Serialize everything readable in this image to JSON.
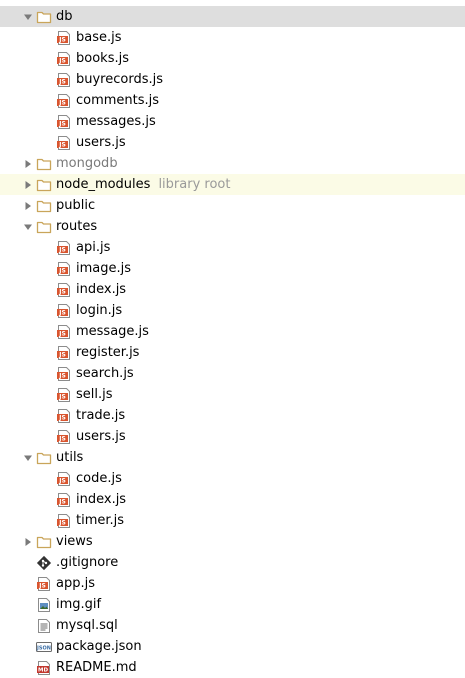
{
  "tree": [
    {
      "label": "db",
      "depth": 0,
      "type": "folder",
      "expanded": true,
      "selected": true
    },
    {
      "label": "base.js",
      "depth": 1,
      "type": "js"
    },
    {
      "label": "books.js",
      "depth": 1,
      "type": "js"
    },
    {
      "label": "buyrecords.js",
      "depth": 1,
      "type": "js"
    },
    {
      "label": "comments.js",
      "depth": 1,
      "type": "js"
    },
    {
      "label": "messages.js",
      "depth": 1,
      "type": "js"
    },
    {
      "label": "users.js",
      "depth": 1,
      "type": "js"
    },
    {
      "label": "mongodb",
      "depth": 0,
      "type": "folder",
      "expanded": false,
      "dim": true
    },
    {
      "label": "node_modules",
      "depth": 0,
      "type": "folder",
      "expanded": false,
      "hint": "library root"
    },
    {
      "label": "public",
      "depth": 0,
      "type": "folder",
      "expanded": false
    },
    {
      "label": "routes",
      "depth": 0,
      "type": "folder",
      "expanded": true
    },
    {
      "label": "api.js",
      "depth": 1,
      "type": "js"
    },
    {
      "label": "image.js",
      "depth": 1,
      "type": "js"
    },
    {
      "label": "index.js",
      "depth": 1,
      "type": "js"
    },
    {
      "label": "login.js",
      "depth": 1,
      "type": "js"
    },
    {
      "label": "message.js",
      "depth": 1,
      "type": "js"
    },
    {
      "label": "register.js",
      "depth": 1,
      "type": "js"
    },
    {
      "label": "search.js",
      "depth": 1,
      "type": "js"
    },
    {
      "label": "sell.js",
      "depth": 1,
      "type": "js"
    },
    {
      "label": "trade.js",
      "depth": 1,
      "type": "js"
    },
    {
      "label": "users.js",
      "depth": 1,
      "type": "js"
    },
    {
      "label": "utils",
      "depth": 0,
      "type": "folder",
      "expanded": true
    },
    {
      "label": "code.js",
      "depth": 1,
      "type": "js"
    },
    {
      "label": "index.js",
      "depth": 1,
      "type": "js"
    },
    {
      "label": "timer.js",
      "depth": 1,
      "type": "js"
    },
    {
      "label": "views",
      "depth": 0,
      "type": "folder",
      "expanded": false
    },
    {
      "label": ".gitignore",
      "depth": 0,
      "type": "git"
    },
    {
      "label": "app.js",
      "depth": 0,
      "type": "js"
    },
    {
      "label": "img.gif",
      "depth": 0,
      "type": "image"
    },
    {
      "label": "mysql.sql",
      "depth": 0,
      "type": "sql"
    },
    {
      "label": "package.json",
      "depth": 0,
      "type": "json"
    },
    {
      "label": "README.md",
      "depth": 0,
      "type": "md"
    }
  ],
  "colors": {
    "folder": "#c9a55a",
    "js_badge": "#d9552f",
    "arrow": "#7a7a7a",
    "selected_bg": "#dedede",
    "library_bg": "#fbfbe6"
  },
  "icons": {
    "folder": "folder-icon",
    "js": "js-file-icon",
    "git": "git-file-icon",
    "image": "image-file-icon",
    "sql": "sql-file-icon",
    "json": "json-file-icon",
    "md": "markdown-file-icon",
    "expanded": "chevron-down-icon",
    "collapsed": "chevron-right-icon"
  }
}
